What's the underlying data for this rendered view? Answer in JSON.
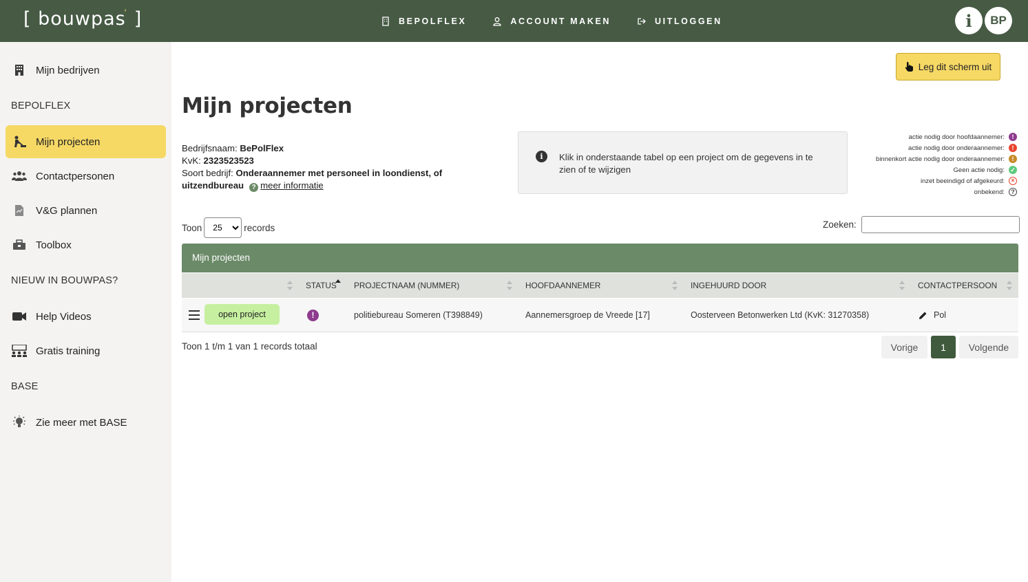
{
  "header": {
    "logo_text": "bouwpas",
    "nav": [
      {
        "label": "BEPOLFLEX",
        "icon": "building-icon"
      },
      {
        "label": "ACCOUNT MAKEN",
        "icon": "user-icon"
      },
      {
        "label": "UITLOGGEN",
        "icon": "logout-icon"
      }
    ],
    "info_label": "i",
    "avatar_initials": "BP"
  },
  "sidebar": {
    "items": [
      {
        "label": "Mijn bedrijven",
        "icon": "building-icon"
      },
      {
        "label": "Mijn projecten",
        "icon": "worker-icon",
        "active": true
      },
      {
        "label": "Contactpersonen",
        "icon": "users-icon"
      },
      {
        "label": "V&G plannen",
        "icon": "document-icon"
      },
      {
        "label": "Toolbox",
        "icon": "toolbox-icon"
      },
      {
        "label": "Help Videos",
        "icon": "video-icon"
      },
      {
        "label": "Gratis training",
        "icon": "training-icon"
      },
      {
        "label": "Zie meer met BASE",
        "icon": "lightbulb-icon"
      }
    ],
    "sections": [
      "BEPOLFLEX",
      "NIEUW IN BOUWPAS?",
      "BASE"
    ]
  },
  "main": {
    "explain_button": "Leg dit scherm uit",
    "title": "Mijn projecten",
    "company": {
      "name_label": "Bedrijfsnaam:",
      "name": "BePolFlex",
      "kvk_label": "KvK:",
      "kvk": "2323523523",
      "type_label": "Soort bedrijf:",
      "type": "Onderaannemer met personeel in loondienst, of uitzendbureau",
      "more_info": "meer informatie"
    },
    "info_text": "Klik in onderstaande tabel op een project om de gegevens in te zien of te wijzigen",
    "legend": [
      {
        "label": "actie nodig door hoofdaannemer:",
        "color": "#8e3b8f",
        "glyph": "!"
      },
      {
        "label": "actie nodig door onderaannemer:",
        "color": "#e8442e",
        "glyph": "!"
      },
      {
        "label": "binnenkort actie nodig door onderaannemer:",
        "color": "#c88a28",
        "glyph": "!"
      },
      {
        "label": "Geen actie nodig:",
        "color": "#5ecb7e",
        "glyph": "✓"
      },
      {
        "label": "inzet beeindigd of afgekeurd:",
        "color": "#e8442e",
        "glyph": "×"
      },
      {
        "label": "onbekend:",
        "color": "#444444",
        "glyph": "?"
      }
    ],
    "length": {
      "prefix": "Toon",
      "value": "25",
      "suffix": "records"
    },
    "search_label": "Zoeken:",
    "table": {
      "title": "Mijn projecten",
      "columns": [
        "STATUS",
        "PROJECTNAAM (NUMMER)",
        "HOOFDAANNEMER",
        "INGEHUURD DOOR",
        "CONTACTPERSOON"
      ],
      "rows": [
        {
          "action": "open project",
          "status_color": "#8e3b8f",
          "project": "politiebureau Someren (T398849)",
          "main_contractor": "Aannemersgroep de Vreede [17]",
          "hired_by": "Oosterveen Betonwerken Ltd (KvK: 31270358)",
          "contact": "Pol"
        }
      ]
    },
    "footer_count": "Toon 1 t/m 1 van 1 records totaal",
    "pager": {
      "prev": "Vorige",
      "current": "1",
      "next": "Volgende"
    }
  }
}
